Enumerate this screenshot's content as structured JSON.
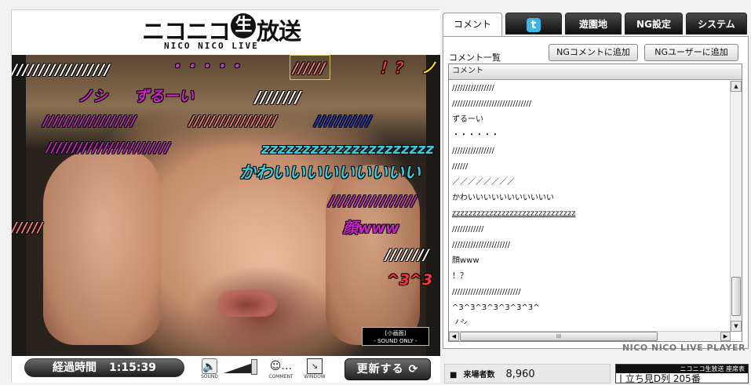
{
  "logo": {
    "title_left": "ニコニコ",
    "badge": "生",
    "title_right": "放送",
    "subtitle": "NICO NICO LIVE"
  },
  "overlay_comments": [
    {
      "text": "//////////////////",
      "color": "#ffffff"
    },
    {
      "text": "・・・・・",
      "color": "#cc33cc"
    },
    {
      "text": "//////",
      "color": "#ff7777"
    },
    {
      "text": "！？",
      "color": "#ff3333"
    },
    {
      "text": "ノ",
      "color": "#ffdd00"
    },
    {
      "text": "ノシ",
      "color": "#cc22cc"
    },
    {
      "text": "ずるーい",
      "color": "#cc22cc"
    },
    {
      "text": "////////",
      "color": "#ffffff"
    },
    {
      "text": "//////////////////",
      "color": "#cc22cc"
    },
    {
      "text": "/////////////////",
      "color": "#ff7777"
    },
    {
      "text": "///////////",
      "color": "#2233dd"
    },
    {
      "text": "////////////////////////",
      "color": "#cc22cc"
    },
    {
      "text": "zzzzzzzzzzzzzzzzzzzzz",
      "color": "#33ccdd"
    },
    {
      "text": "かわいいいいいいいいい",
      "color": "#33ccdd"
    },
    {
      "text": "/////////////////",
      "color": "#cc22cc"
    },
    {
      "text": "//////",
      "color": "#ff7777"
    },
    {
      "text": "顔www",
      "color": "#cc22cc"
    },
    {
      "text": "////////",
      "color": "#ffffff"
    },
    {
      "text": "^3^3",
      "color": "#ff3333"
    }
  ],
  "sound_only": {
    "line1": "[小画面]",
    "line2": "- SOUND ONLY -"
  },
  "controls": {
    "elapsed_label": "経過時間",
    "elapsed_time": "1:15:39",
    "sound_label": "SOUND",
    "comment_label": "COMMENT",
    "window_label": "WINDOW",
    "refresh_label": "更新する"
  },
  "tabs": {
    "comment": "コメント",
    "twitter": "t",
    "amusement": "遊園地",
    "ng": "NG設定",
    "system": "システム"
  },
  "panel": {
    "list_label": "コメント一覧",
    "ng_comment_button": "NGコメントに追加",
    "ng_user_button": "NGユーザーに追加",
    "column_header": "コメント",
    "rows": [
      "////////////////",
      "//////////////////////////////",
      "ずるーい",
      "・・・・・・",
      "////////////////",
      "//////",
      "／／／／／／／／",
      "かわいいいいいいいいいいい",
      "zzzzzzzzzzzzzzzzzzzzzzzzzzzzzz",
      "////////////",
      "//////////////////////",
      "顔www",
      "！？",
      "//////////////////////////",
      "^3^3^3^3^3^3^3^",
      "ノシ"
    ],
    "hscroll_grip": "III",
    "brand": "NICO NICO LIVE PLAYER"
  },
  "footer": {
    "visitors_label": "来場者数",
    "visitors_value": "8,960",
    "seat_title": "ニコニコ生放送 座席表",
    "seat_text": "| 立ち見D列 205番"
  }
}
